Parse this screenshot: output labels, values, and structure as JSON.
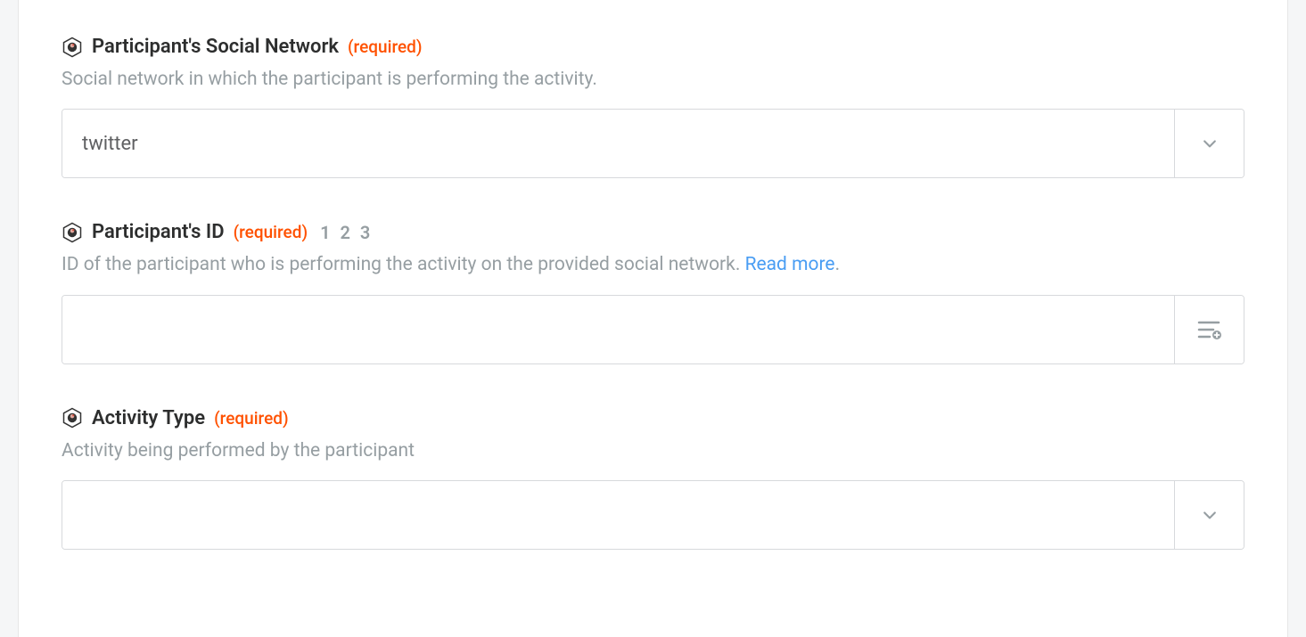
{
  "fields": {
    "social_network": {
      "label": "Participant's Social Network",
      "required_text": "(required)",
      "description": "Social network in which the participant is performing the activity.",
      "value": "twitter"
    },
    "participant_id": {
      "label": "Participant's ID",
      "required_text": "(required)",
      "hint_badge": "1 2 3",
      "description": "ID of the participant who is performing the activity on the provided social network. ",
      "read_more": "Read more",
      "value": ""
    },
    "activity_type": {
      "label": "Activity Type",
      "required_text": "(required)",
      "description": "Activity being performed by the participant",
      "value": ""
    }
  }
}
